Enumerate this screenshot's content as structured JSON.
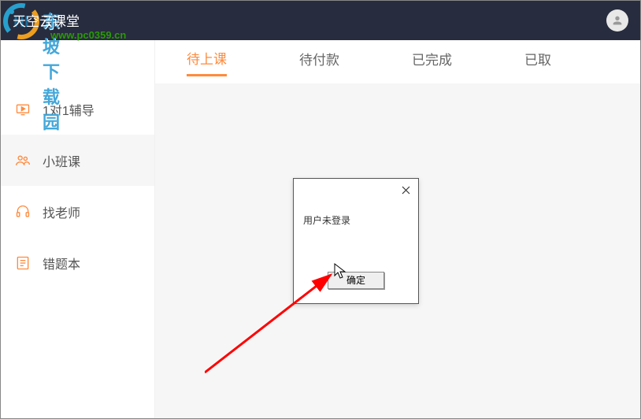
{
  "header": {
    "title": "天空云课堂"
  },
  "watermark": {
    "text": "东坡下载园",
    "url": "www.pc0359.cn"
  },
  "sidebar": {
    "items": [
      {
        "label": "1对1辅导"
      },
      {
        "label": "小班课"
      },
      {
        "label": "找老师"
      },
      {
        "label": "错题本"
      }
    ]
  },
  "tabs": {
    "items": [
      {
        "label": "待上课"
      },
      {
        "label": "待付款"
      },
      {
        "label": "已完成"
      },
      {
        "label": "已取"
      }
    ]
  },
  "dialog": {
    "message": "用户未登录",
    "confirm": "确定"
  }
}
